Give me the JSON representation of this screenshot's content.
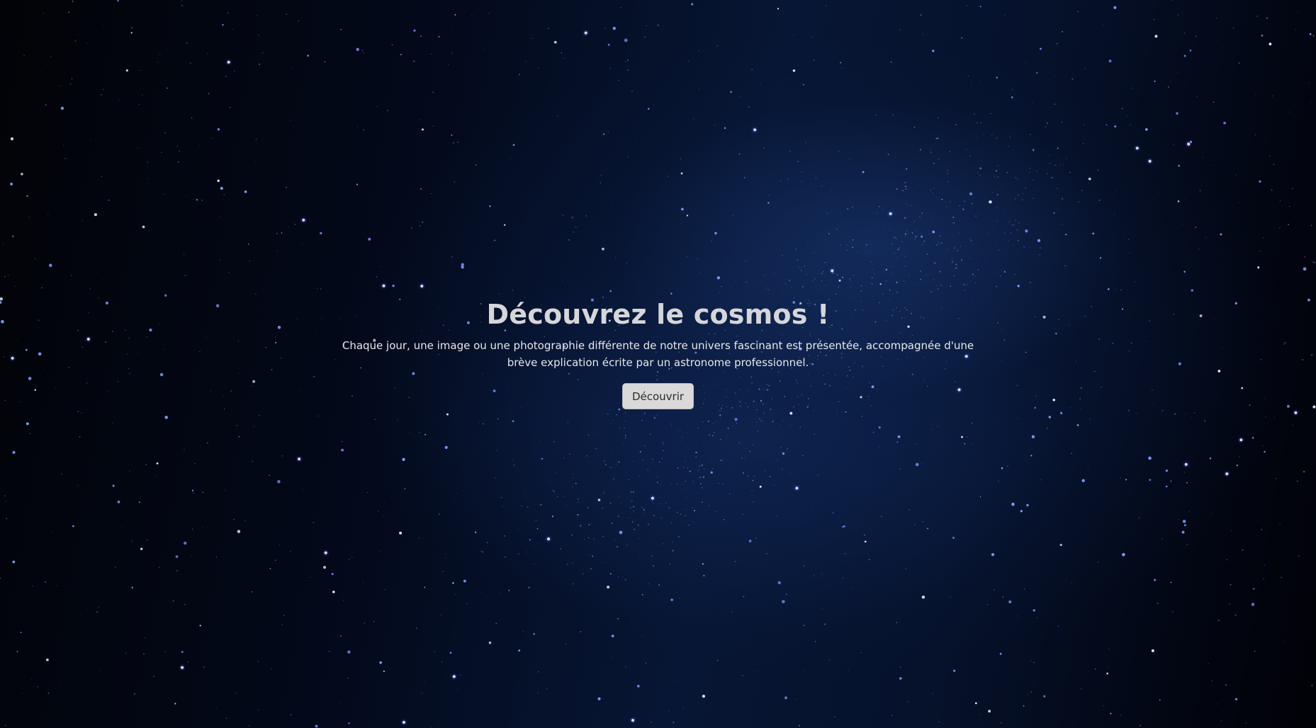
{
  "hero": {
    "title": "Découvrez le cosmos !",
    "description": "Chaque jour, une image ou une photographie différente de notre univers fascinant est présentée, accompagnée d'une brève explication écrite par un astronome professionnel.",
    "button_label": "Découvrir"
  },
  "colors": {
    "text_light": "#d6d6d9",
    "button_background": "#d9d9d9",
    "button_text": "#2b2b2b",
    "star_blue": "#7d9bff"
  },
  "background": {
    "image_semantic": "starry-night-sky-with-milky-way"
  }
}
